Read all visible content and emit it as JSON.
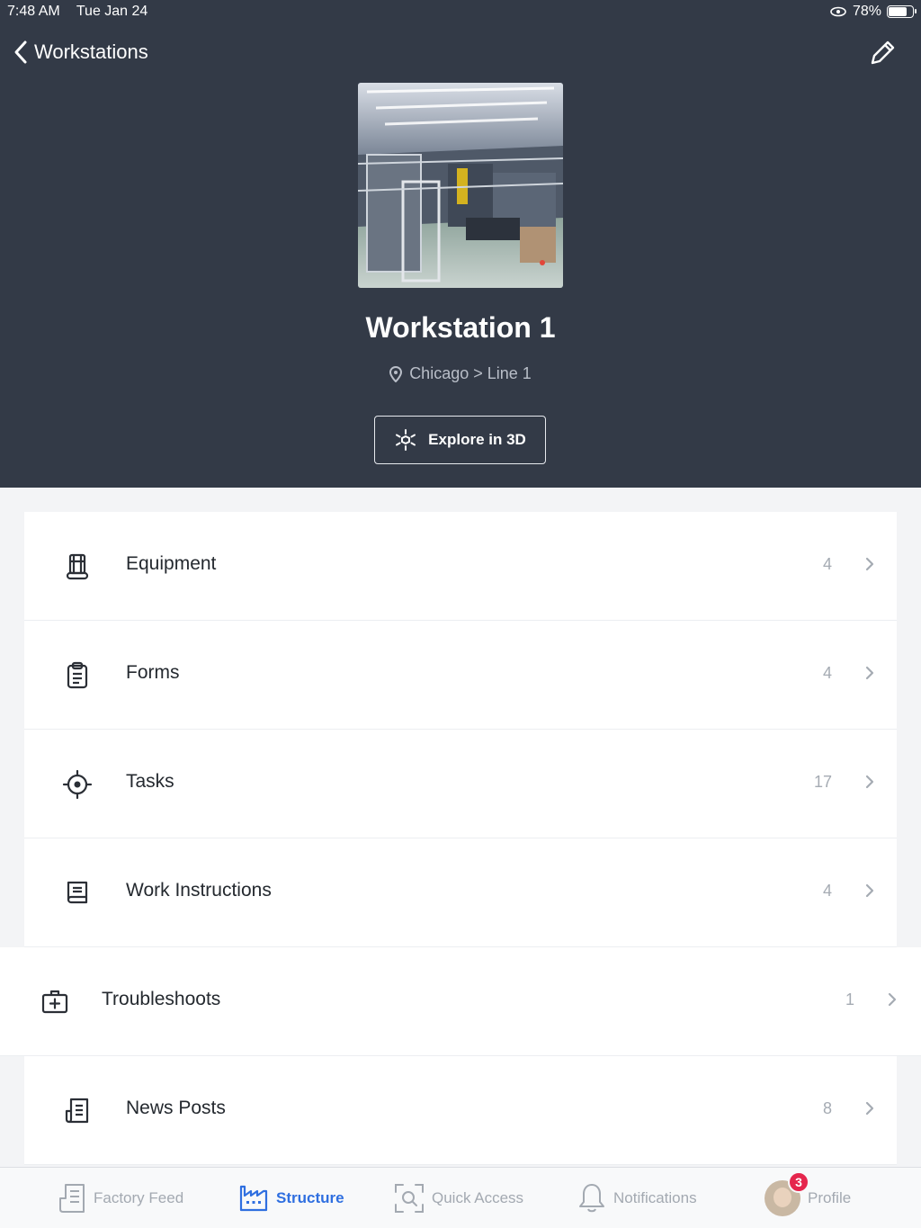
{
  "status_bar": {
    "time": "7:48 AM",
    "date": "Tue Jan 24",
    "battery": "78%",
    "battery_level": 0.78
  },
  "nav": {
    "back_label": "Workstations"
  },
  "workstation": {
    "title": "Workstation 1",
    "location": "Chicago > Line 1",
    "explore_label": "Explore in 3D"
  },
  "rows": [
    {
      "label": "Equipment",
      "count": "4",
      "icon": "equipment-icon"
    },
    {
      "label": "Forms",
      "count": "4",
      "icon": "clipboard-icon"
    },
    {
      "label": "Tasks",
      "count": "17",
      "icon": "target-icon"
    },
    {
      "label": "Work Instructions",
      "count": "4",
      "icon": "book-icon"
    },
    {
      "label": "Troubleshoots",
      "count": "1",
      "icon": "first-aid-icon"
    },
    {
      "label": "News Posts",
      "count": "8",
      "icon": "newspaper-icon"
    }
  ],
  "tabs": [
    {
      "label": "Factory Feed",
      "icon": "feed-icon",
      "active": false
    },
    {
      "label": "Structure",
      "icon": "factory-icon",
      "active": true
    },
    {
      "label": "Quick Access",
      "icon": "scan-icon",
      "active": false
    },
    {
      "label": "Notifications",
      "icon": "bell-icon",
      "active": false
    },
    {
      "label": "Profile",
      "icon": "avatar",
      "active": false,
      "badge": "3"
    }
  ],
  "colors": {
    "header_bg": "#333a47",
    "accent": "#2f6fe0",
    "badge": "#e5264d"
  }
}
